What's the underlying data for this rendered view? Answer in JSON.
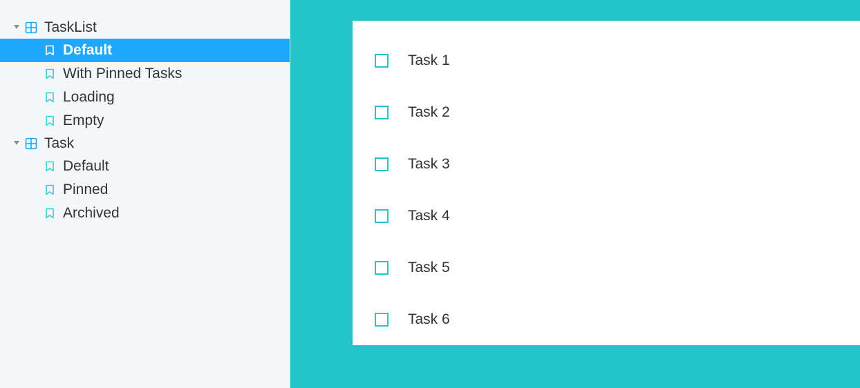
{
  "sidebar": {
    "groups": [
      {
        "label": "TaskList",
        "items": [
          {
            "label": "Default",
            "selected": true
          },
          {
            "label": "With Pinned Tasks",
            "selected": false
          },
          {
            "label": "Loading",
            "selected": false
          },
          {
            "label": "Empty",
            "selected": false
          }
        ]
      },
      {
        "label": "Task",
        "items": [
          {
            "label": "Default",
            "selected": false
          },
          {
            "label": "Pinned",
            "selected": false
          },
          {
            "label": "Archived",
            "selected": false
          }
        ]
      }
    ]
  },
  "preview": {
    "tasks": [
      {
        "title": "Task 1",
        "checked": false
      },
      {
        "title": "Task 2",
        "checked": false
      },
      {
        "title": "Task 3",
        "checked": false
      },
      {
        "title": "Task 4",
        "checked": false
      },
      {
        "title": "Task 5",
        "checked": false
      },
      {
        "title": "Task 6",
        "checked": false
      }
    ]
  },
  "colors": {
    "accent": "#1ea7fd",
    "teal": "#28c3c8",
    "previewBg": "#23c4ca",
    "sidebarBg": "#f5f8fa"
  }
}
